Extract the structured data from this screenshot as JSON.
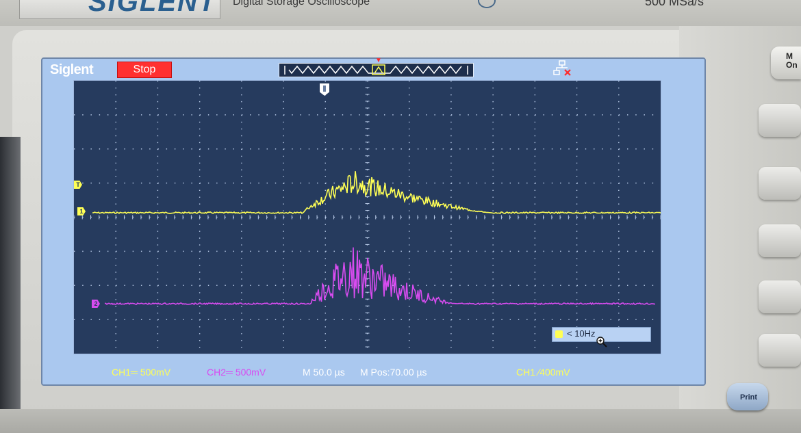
{
  "device": {
    "brand": "SIGLENT",
    "description": "Digital Storage Oscilloscope",
    "sample_rate": "500 MSa/s"
  },
  "screen": {
    "logo": "Siglent",
    "run_status": "Stop"
  },
  "status_bar": {
    "ch1_scale": "CH1═ 500mV",
    "ch2_scale": "CH2═ 500mV",
    "timebase": "M 50.0 µs",
    "horizontal_position": "M Pos:70.00 µs",
    "trigger": "CH1 ⁄400mV"
  },
  "frequency_counter": "< 10Hz",
  "side_panel": {
    "menu_label": "M\nOn",
    "print_label": "Print"
  },
  "colors": {
    "ch1": "#ffff55",
    "ch2": "#d84cf0",
    "stop": "#ff3030",
    "grid_background": "#263b5e"
  },
  "icons": [
    "network-icon",
    "zoom-cursor-icon",
    "channel-1-marker",
    "channel-2-marker",
    "trigger-position-marker"
  ]
}
